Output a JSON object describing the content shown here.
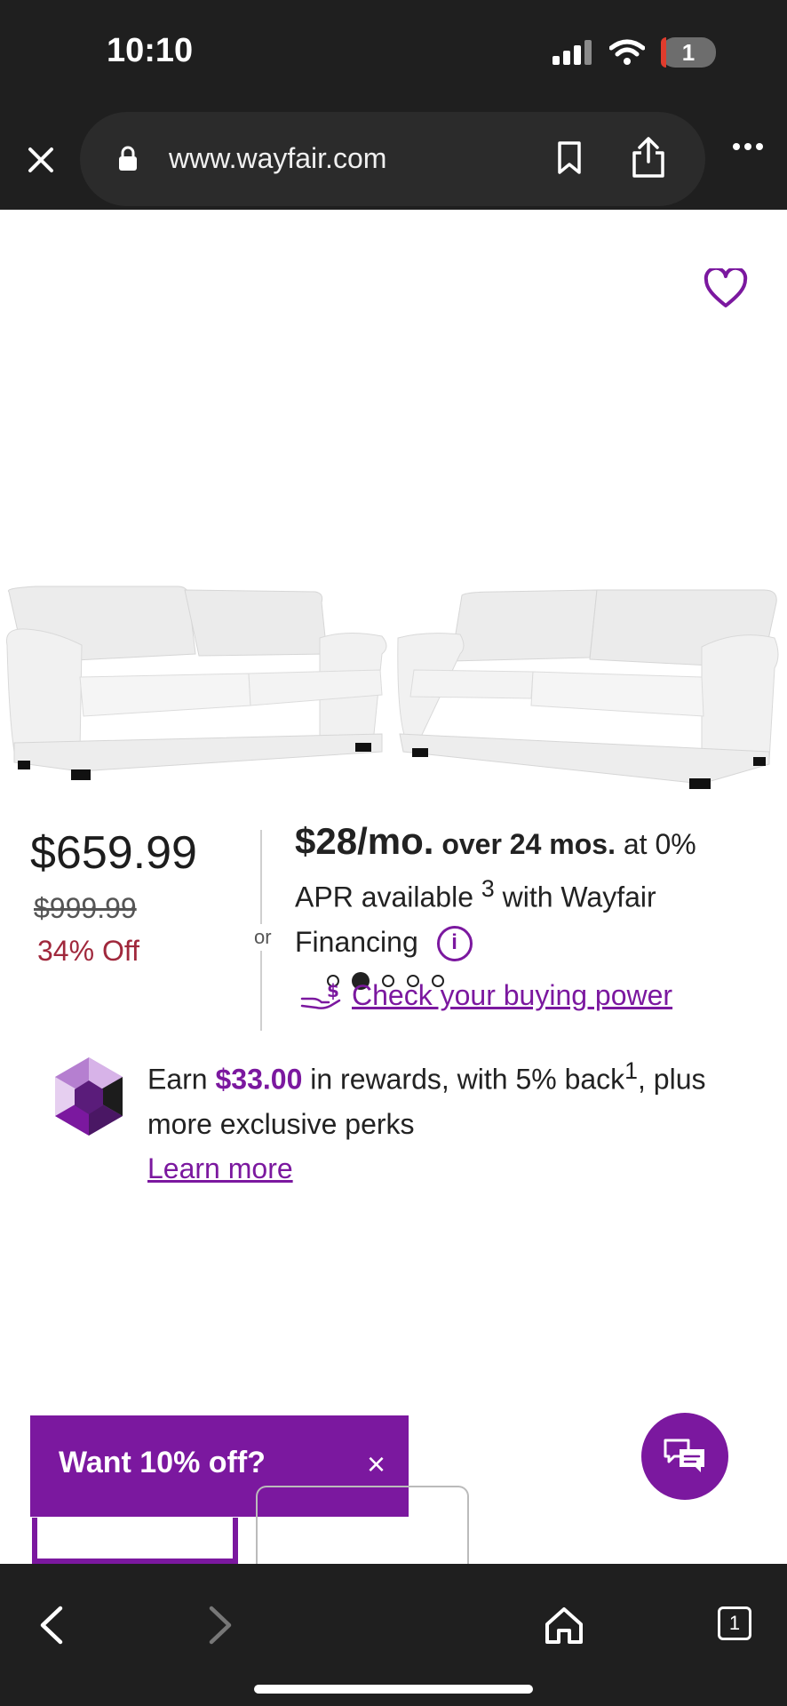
{
  "status_bar": {
    "time": "10:10",
    "tab_count": "1"
  },
  "browser": {
    "url": "www.wayfair.com"
  },
  "carousel": {
    "total": 5,
    "active_index": 2
  },
  "pricing": {
    "price": "$659.99",
    "original_price": "$999.99",
    "discount": "34% Off",
    "or_label": "or",
    "monthly": "$28/mo.",
    "term": "over 24 mos.",
    "apr": "at 0% APR available",
    "sup": "3",
    "financing": "with Wayfair Financing",
    "info_symbol": "i",
    "buying_power_link": "Check your buying power"
  },
  "rewards": {
    "prefix": "Earn",
    "amount": "$33.00",
    "middle": "in rewards, with 5% back",
    "sup": "1",
    "suffix": ", plus more exclusive perks",
    "learn_more": "Learn more"
  },
  "promo": {
    "title": "Want 10% off?",
    "close_symbol": "×"
  },
  "bottom_nav": {
    "tabs": "1"
  },
  "colors": {
    "brand_purple": "#7b189f",
    "discount_red": "#a0283c",
    "chrome_dark": "#1f1f1f"
  }
}
